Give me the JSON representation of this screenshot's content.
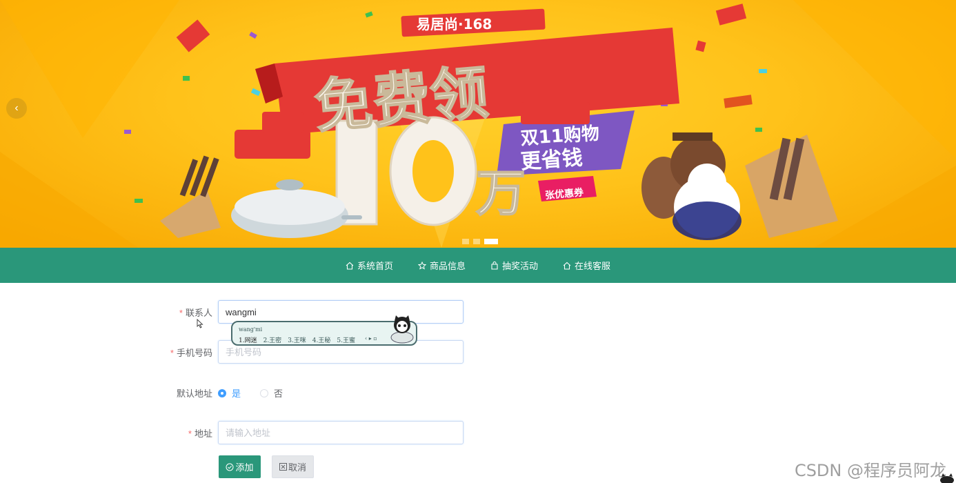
{
  "banner": {
    "brand": "易居尚·168",
    "headline": "免费领",
    "amount": "10",
    "unit": "万",
    "tag_line1": "双11购物",
    "tag_line2": "更省钱",
    "coupon": "张优惠券",
    "prev_icon": "chevron-left-icon",
    "slide_count": 3,
    "active_slide": 3
  },
  "nav": {
    "items": [
      {
        "label": "系统首页",
        "icon": "home-icon"
      },
      {
        "label": "商品信息",
        "icon": "star-icon"
      },
      {
        "label": "抽奖活动",
        "icon": "bag-icon"
      },
      {
        "label": "在线客服",
        "icon": "home-icon"
      }
    ],
    "bg_color": "#2a977a"
  },
  "form": {
    "contact": {
      "label": "联系人",
      "value": "wangmi"
    },
    "phone": {
      "label": "手机号码",
      "placeholder": "手机号码"
    },
    "default_address": {
      "label": "默认地址",
      "options": [
        "是",
        "否"
      ],
      "selected": "是"
    },
    "address": {
      "label": "地址",
      "placeholder": "请输入地址"
    },
    "add_button": "添加",
    "cancel_button": "取消"
  },
  "ime": {
    "composition": "wang'mi",
    "candidates": [
      "1.网迷",
      "2.王密",
      "3.王咪",
      "4.王秘",
      "5.王蜜"
    ]
  },
  "watermark": "CSDN @程序员阿龙"
}
